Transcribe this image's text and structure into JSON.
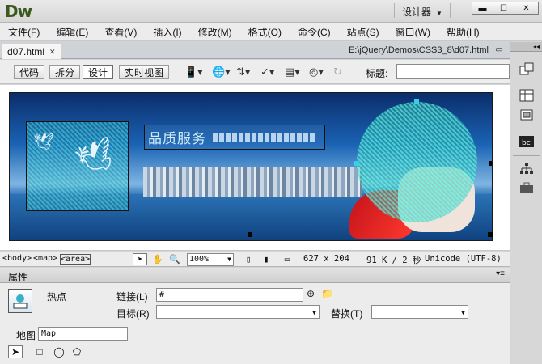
{
  "app": {
    "logo": "Dw",
    "workspace": "设计器"
  },
  "menu": [
    "文件(F)",
    "编辑(E)",
    "查看(V)",
    "插入(I)",
    "修改(M)",
    "格式(O)",
    "命令(C)",
    "站点(S)",
    "窗口(W)",
    "帮助(H)"
  ],
  "document": {
    "tab": "d07.html",
    "path": "E:\\jQuery\\Demos\\CSS3_8\\d07.html"
  },
  "toolbar": {
    "views": [
      "代码",
      "拆分",
      "设计",
      "实时视图"
    ],
    "active_view": "设计",
    "title_label": "标题:",
    "title_value": ""
  },
  "banner": {
    "heading": "品质服务"
  },
  "statusbar": {
    "tags": [
      "<body>",
      "<map>",
      "<area>"
    ],
    "zoom": "100%",
    "size": "627 x 204",
    "download": "91 K / 2 秒",
    "encoding": "Unicode (UTF-8)"
  },
  "properties": {
    "header": "属性",
    "type_label": "热点",
    "link_label": "链接(L)",
    "link_value": "#",
    "target_label": "目标(R)",
    "target_value": "",
    "alt_label": "替换(T)",
    "alt_value": "",
    "map_label": "地图",
    "map_value": "Map"
  },
  "icons": {
    "rightstrip": [
      "expand-panels-icon",
      "css-styles-icon",
      "ap-elements-icon",
      "business-catalyst-icon",
      "files-icon",
      "assets-icon"
    ],
    "accent": "#3d5a1e"
  }
}
